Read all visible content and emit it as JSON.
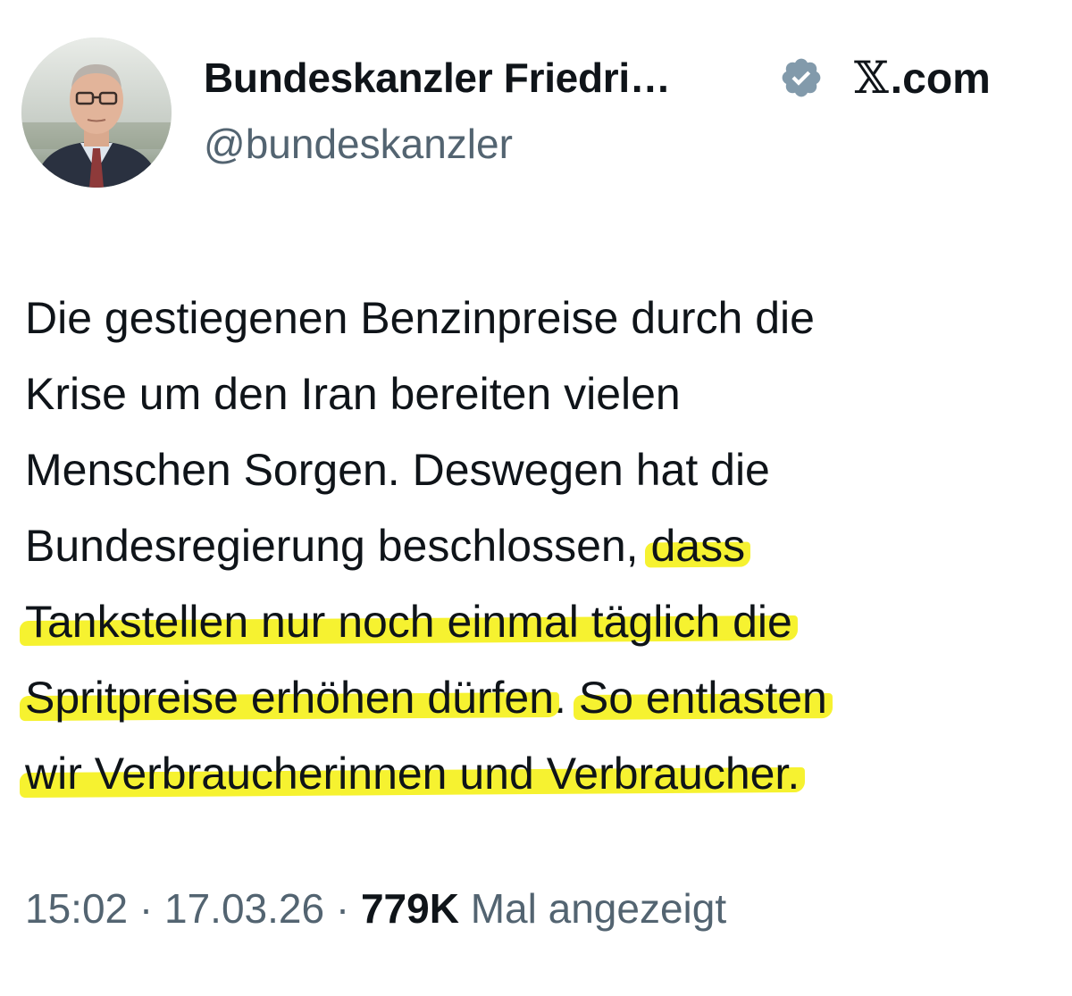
{
  "header": {
    "display_name": "Bundeskanzler Friedri…",
    "handle": "@bundeskanzler",
    "source": {
      "x_mark": "𝕏",
      "domain": ".com"
    },
    "verified_icon": "verified-badge-icon",
    "verified_color": "#829aab"
  },
  "tweet": {
    "lines": [
      {
        "plain": "Die gestiegenen Benzinpreise durch die"
      },
      {
        "plain": "Krise um den Iran bereiten vielen"
      },
      {
        "plain": "Menschen Sorgen. Deswegen hat die"
      },
      {
        "plain": "Bundesregierung beschlossen, ",
        "highlight": "dass"
      },
      {
        "highlight": "Tankstellen nur noch einmal täglich die"
      },
      {
        "highlight": "Spritpreise erhöhen dürfen",
        "plain": ". ",
        "highlight2": "So entlasten"
      },
      {
        "highlight": "wir Verbraucherinnen und Verbraucher."
      }
    ],
    "highlight_color": "#f6f230"
  },
  "meta": {
    "time": "15:02",
    "sep1": " · ",
    "date": "17.03.26",
    "sep2": " · ",
    "views": "779K",
    "views_label": " Mal angezeigt"
  }
}
